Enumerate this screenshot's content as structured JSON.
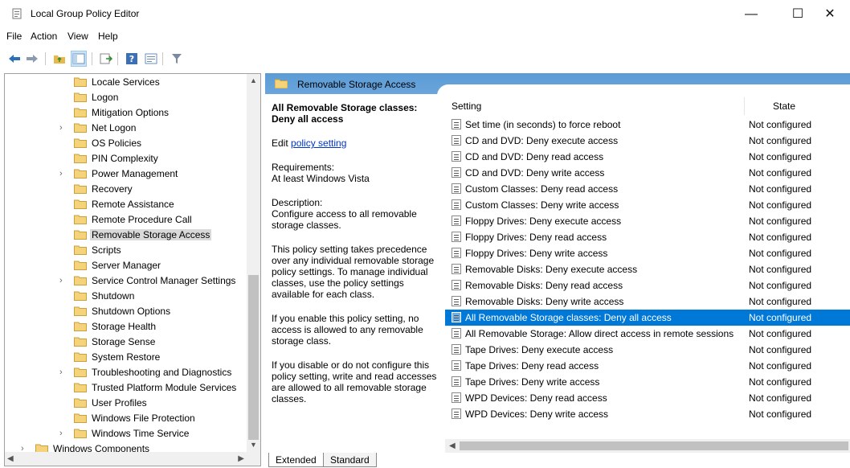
{
  "window": {
    "title": "Local Group Policy Editor",
    "minimize": "—",
    "maximize": "☐",
    "close": "✕"
  },
  "menu": [
    "File",
    "Action",
    "View",
    "Help"
  ],
  "toolbar": {
    "icons": [
      "back-icon",
      "forward-icon",
      "up-folder-icon",
      "show-hide-tree-icon",
      "export-list-icon",
      "help-icon",
      "properties-icon",
      "filter-icon"
    ]
  },
  "tree": {
    "items": [
      {
        "label": "Locale Services",
        "expandable": false,
        "selected": false
      },
      {
        "label": "Logon",
        "expandable": false,
        "selected": false
      },
      {
        "label": "Mitigation Options",
        "expandable": false,
        "selected": false
      },
      {
        "label": "Net Logon",
        "expandable": true,
        "selected": false
      },
      {
        "label": "OS Policies",
        "expandable": false,
        "selected": false
      },
      {
        "label": "PIN Complexity",
        "expandable": false,
        "selected": false
      },
      {
        "label": "Power Management",
        "expandable": true,
        "selected": false
      },
      {
        "label": "Recovery",
        "expandable": false,
        "selected": false
      },
      {
        "label": "Remote Assistance",
        "expandable": false,
        "selected": false
      },
      {
        "label": "Remote Procedure Call",
        "expandable": false,
        "selected": false
      },
      {
        "label": "Removable Storage Access",
        "expandable": false,
        "selected": true
      },
      {
        "label": "Scripts",
        "expandable": false,
        "selected": false
      },
      {
        "label": "Server Manager",
        "expandable": false,
        "selected": false
      },
      {
        "label": "Service Control Manager Settings",
        "expandable": true,
        "selected": false
      },
      {
        "label": "Shutdown",
        "expandable": false,
        "selected": false
      },
      {
        "label": "Shutdown Options",
        "expandable": false,
        "selected": false
      },
      {
        "label": "Storage Health",
        "expandable": false,
        "selected": false
      },
      {
        "label": "Storage Sense",
        "expandable": false,
        "selected": false
      },
      {
        "label": "System Restore",
        "expandable": false,
        "selected": false
      },
      {
        "label": "Troubleshooting and Diagnostics",
        "expandable": true,
        "selected": false
      },
      {
        "label": "Trusted Platform Module Services",
        "expandable": false,
        "selected": false
      },
      {
        "label": "User Profiles",
        "expandable": false,
        "selected": false
      },
      {
        "label": "Windows File Protection",
        "expandable": false,
        "selected": false
      },
      {
        "label": "Windows Time Service",
        "expandable": true,
        "selected": false
      },
      {
        "label": "Windows Components",
        "expandable": true,
        "selected": false
      }
    ]
  },
  "right_pane": {
    "header": "Removable Storage Access",
    "desc": {
      "title": "All Removable Storage classes: Deny all access",
      "edit_prefix": "Edit ",
      "edit_link": "policy setting",
      "requirements": "Requirements:\nAt least Windows Vista",
      "description": "Description:\nConfigure access to all removable storage classes.",
      "para1": "This policy setting takes precedence over any individual removable storage policy settings. To manage individual classes, use the policy settings available for each class.",
      "para2": "If you enable this policy setting, no access is allowed to any removable storage class.",
      "para3": "If you disable or do not configure this policy setting, write and read accesses are allowed to all removable storage classes."
    },
    "columns": {
      "setting": "Setting",
      "state": "State"
    },
    "rows": [
      {
        "name": "Set time (in seconds) to force reboot",
        "state": "Not configured",
        "selected": false
      },
      {
        "name": "CD and DVD: Deny execute access",
        "state": "Not configured",
        "selected": false
      },
      {
        "name": "CD and DVD: Deny read access",
        "state": "Not configured",
        "selected": false
      },
      {
        "name": "CD and DVD: Deny write access",
        "state": "Not configured",
        "selected": false
      },
      {
        "name": "Custom Classes: Deny read access",
        "state": "Not configured",
        "selected": false
      },
      {
        "name": "Custom Classes: Deny write access",
        "state": "Not configured",
        "selected": false
      },
      {
        "name": "Floppy Drives: Deny execute access",
        "state": "Not configured",
        "selected": false
      },
      {
        "name": "Floppy Drives: Deny read access",
        "state": "Not configured",
        "selected": false
      },
      {
        "name": "Floppy Drives: Deny write access",
        "state": "Not configured",
        "selected": false
      },
      {
        "name": "Removable Disks: Deny execute access",
        "state": "Not configured",
        "selected": false
      },
      {
        "name": "Removable Disks: Deny read access",
        "state": "Not configured",
        "selected": false
      },
      {
        "name": "Removable Disks: Deny write access",
        "state": "Not configured",
        "selected": false
      },
      {
        "name": "All Removable Storage classes: Deny all access",
        "state": "Not configured",
        "selected": true
      },
      {
        "name": "All Removable Storage: Allow direct access in remote sessions",
        "state": "Not configured",
        "selected": false
      },
      {
        "name": "Tape Drives: Deny execute access",
        "state": "Not configured",
        "selected": false
      },
      {
        "name": "Tape Drives: Deny read access",
        "state": "Not configured",
        "selected": false
      },
      {
        "name": "Tape Drives: Deny write access",
        "state": "Not configured",
        "selected": false
      },
      {
        "name": "WPD Devices: Deny read access",
        "state": "Not configured",
        "selected": false
      },
      {
        "name": "WPD Devices: Deny write access",
        "state": "Not configured",
        "selected": false
      }
    ],
    "tabs": [
      "Extended",
      "Standard"
    ]
  },
  "colors": {
    "selection": "#0078d7",
    "header_blue": "#5b9bd5",
    "folder": "#f5d37a",
    "link": "#0033cc"
  }
}
